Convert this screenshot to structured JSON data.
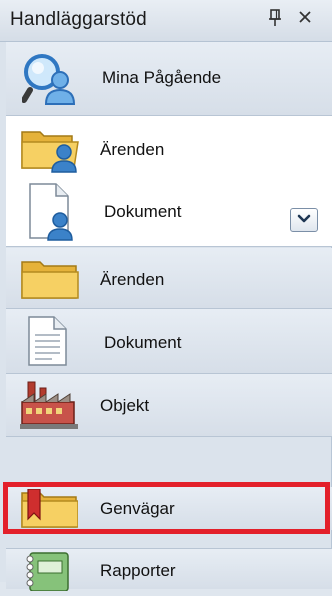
{
  "header": {
    "title": "Handläggarstöd",
    "pin_glyph": "ᵖ",
    "close_glyph": "×"
  },
  "items": {
    "mina_pagaende": {
      "label": "Mina Pågående",
      "icon": "magnifier-person-icon"
    },
    "arenden_search": {
      "label": "Ärenden",
      "icon": "folder-person-icon"
    },
    "dokument_search": {
      "label": "Dokument",
      "icon": "document-person-icon"
    },
    "arenden": {
      "label": "Ärenden",
      "icon": "folder-icon"
    },
    "dokument": {
      "label": "Dokument",
      "icon": "document-icon"
    },
    "objekt": {
      "label": "Objekt",
      "icon": "factory-icon"
    },
    "genvagar": {
      "label": "Genvägar",
      "icon": "bookmark-folder-icon"
    },
    "rapporter": {
      "label": "Rapporter",
      "icon": "notebook-icon"
    }
  },
  "colors": {
    "highlight": "#e3202a",
    "folder": "#f4c646",
    "person": "#2d6fb8"
  }
}
